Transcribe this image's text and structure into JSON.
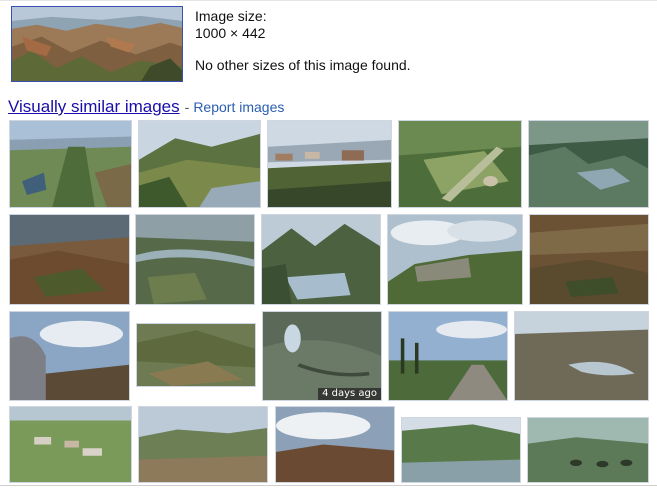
{
  "image_size": {
    "label": "Image size:",
    "dimensions": "1000 × 442",
    "note": "No other sizes of this image found."
  },
  "similar": {
    "title": "Visually similar images",
    "separator": "-",
    "report_label": "Report images"
  },
  "tiles": [
    {
      "badge": ""
    },
    {
      "badge": ""
    },
    {
      "badge": ""
    },
    {
      "badge": ""
    },
    {
      "badge": ""
    },
    {
      "badge": ""
    },
    {
      "badge": ""
    },
    {
      "badge": ""
    },
    {
      "badge": ""
    },
    {
      "badge": ""
    },
    {
      "badge": ""
    },
    {
      "badge": ""
    },
    {
      "badge": "4 days ago"
    },
    {
      "badge": ""
    },
    {
      "badge": ""
    },
    {
      "badge": ""
    },
    {
      "badge": ""
    },
    {
      "badge": ""
    },
    {
      "badge": ""
    },
    {
      "badge": ""
    }
  ]
}
